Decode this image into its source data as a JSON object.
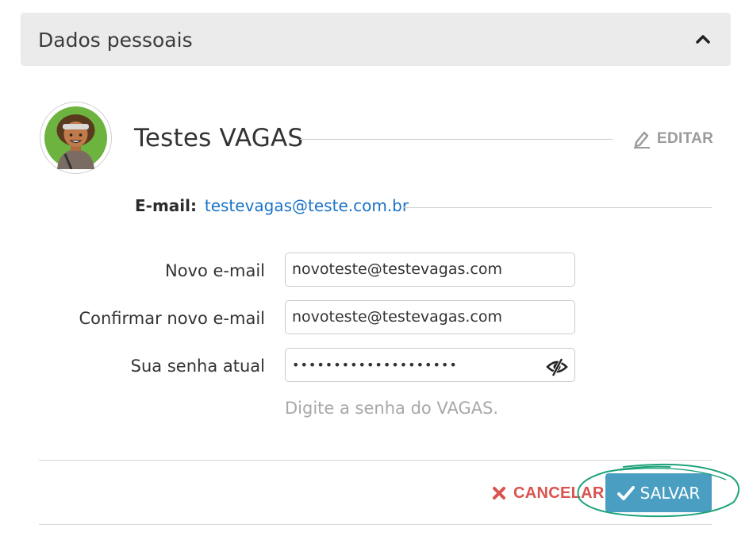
{
  "section": {
    "title": "Dados pessoais",
    "collapse_icon": "chevron-up-icon"
  },
  "profile": {
    "name": "Testes VAGAS",
    "edit_label": "EDITAR",
    "edit_icon": "pencil-icon",
    "email_label": "E-mail:",
    "email": "testevagas@teste.com.br"
  },
  "form": {
    "new_email_label": "Novo e-mail",
    "new_email_value": "novoteste@testevagas.com",
    "confirm_email_label": "Confirmar novo e-mail",
    "confirm_email_value": "novoteste@testevagas.com",
    "password_label": "Sua senha atual",
    "password_mask": "••••••••••••••••••••",
    "password_hint": "Digite a senha do VAGAS.",
    "toggle_icon": "eye-slash-icon"
  },
  "actions": {
    "cancel_label": "CANCELAR",
    "cancel_icon": "x-icon",
    "save_label": "SALVAR",
    "save_icon": "check-icon"
  },
  "colors": {
    "header_bg": "#ebebeb",
    "link": "#1a73c7",
    "cancel": "#d9534f",
    "save_bg": "#4a9ec2",
    "highlight": "#1fa37a"
  }
}
